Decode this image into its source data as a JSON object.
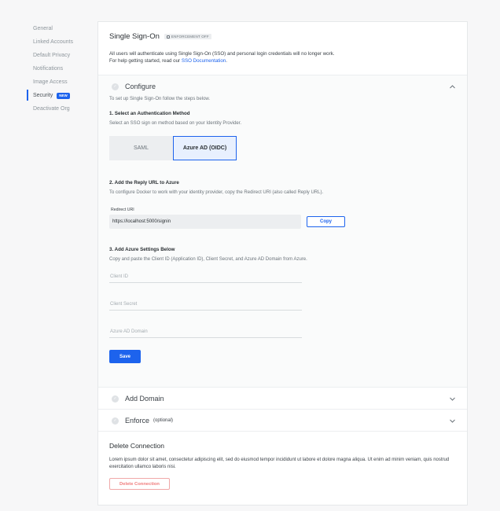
{
  "sidebar": {
    "items": [
      {
        "label": "General"
      },
      {
        "label": "Linked Accounts"
      },
      {
        "label": "Default Privacy"
      },
      {
        "label": "Notifications"
      },
      {
        "label": "Image Access"
      },
      {
        "label": "Security",
        "badge": "NEW",
        "active": true
      },
      {
        "label": "Deactivate Org"
      }
    ]
  },
  "header": {
    "title": "Single Sign-On",
    "badge": "ENFORCEMENT OFF",
    "desc_line1": "All users will authenticate using Single Sign-On (SSO) and personal login credentials will no longer work.",
    "desc_line2_prefix": "For help getting started, read our ",
    "desc_link": "SSO Documentation",
    "desc_line2_suffix": "."
  },
  "configure": {
    "title": "Configure",
    "intro": "To set up Single Sign-On follow the steps below.",
    "step1_title": "1. Select an Authentication Method",
    "step1_desc": "Select an SSO sign on method based on your Identity Provider.",
    "tabs": [
      "SAML",
      "Azure AD (OIDC)"
    ],
    "active_tab": "Azure AD (OIDC)",
    "step2_title": "2. Add the Reply URL to Azure",
    "step2_desc": "To configure Docker to work with your identity provider, copy the Redirect URI (also called Reply URL).",
    "redirect_label": "Redirect URI",
    "redirect_value": "https://localhost:5000/signin",
    "copy_label": "Copy",
    "step3_title": "3. Add Azure Settings Below",
    "step3_desc": "Copy and paste the Client ID (Application ID), Client Secret, and Azure AD Domain from Azure.",
    "client_id_placeholder": "Client ID",
    "client_secret_placeholder": "Client Secret",
    "domain_placeholder": "Azure AD Domain",
    "save_label": "Save"
  },
  "add_domain": {
    "title": "Add Domain"
  },
  "enforce": {
    "title": "Enforce",
    "optional": "(optional)"
  },
  "delete": {
    "title": "Delete Connection",
    "text": "Lorem ipsum dolor sit amet, consectetur adipiscing elit, sed do eiusmod tempor incididunt ut labore et dolore magna aliqua. Ut enim ad minim veniam, quis nostrud exercitation ullamco laboris nisi.",
    "button": "Delete Connection"
  },
  "colors": {
    "accent": "#1d63ed",
    "danger": "#f07c7c"
  }
}
